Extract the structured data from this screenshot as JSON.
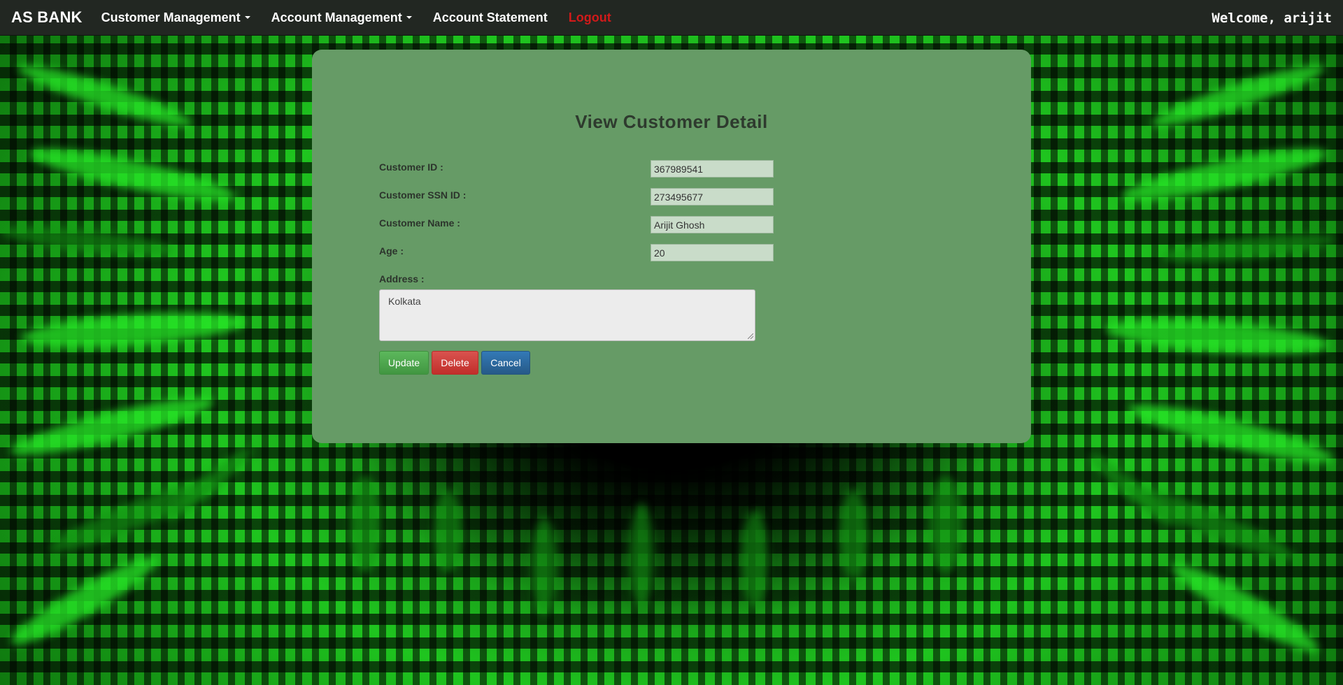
{
  "navbar": {
    "brand": "AS BANK",
    "items": [
      {
        "label": "Customer Management",
        "dropdown": true
      },
      {
        "label": "Account Management",
        "dropdown": true
      },
      {
        "label": "Account Statement",
        "dropdown": false
      },
      {
        "label": "Logout",
        "dropdown": false
      }
    ],
    "welcome": "Welcome, arijit"
  },
  "form": {
    "title": "View Customer Detail",
    "fields": [
      {
        "label": "Customer ID :",
        "value": "367989541"
      },
      {
        "label": "Customer SSN ID :",
        "value": "273495677"
      },
      {
        "label": "Customer Name :",
        "value": "Arijit Ghosh"
      },
      {
        "label": "Age :",
        "value": "20"
      }
    ],
    "address": {
      "label": "Address :",
      "value": "Kolkata"
    },
    "buttons": {
      "update": "Update",
      "delete": "Delete",
      "cancel": "Cancel"
    }
  },
  "colors": {
    "panel": "#669b66",
    "navbar": "#222722",
    "logout": "#d11a1a",
    "update": "#5cb85c",
    "delete": "#d9534f",
    "cancel": "#337ab7"
  }
}
